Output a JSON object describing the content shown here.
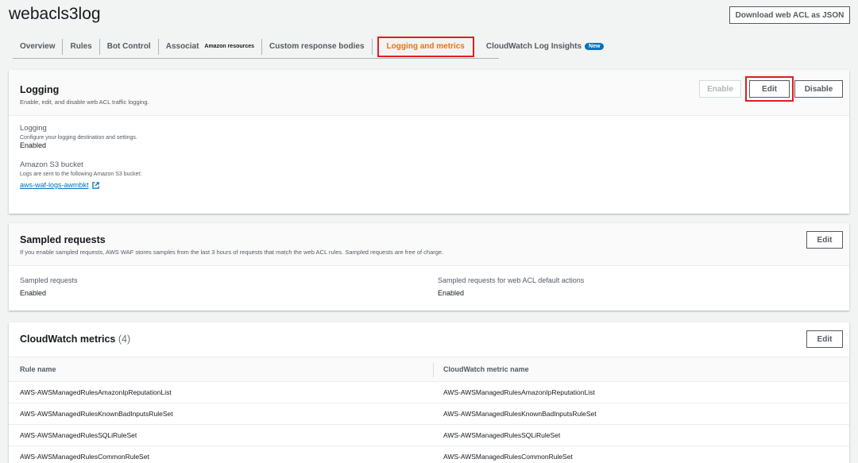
{
  "header": {
    "title": "webacls3log",
    "download_label": "Download web ACL as JSON"
  },
  "tabs": [
    {
      "label": "Overview"
    },
    {
      "label": "Rules"
    },
    {
      "label": "Bot Control"
    },
    {
      "label": "Associat",
      "sub": "Amazon resources"
    },
    {
      "label": "Custom response bodies"
    },
    {
      "label": "Logging and metrics"
    },
    {
      "label": "CloudWatch Log Insights",
      "badge": "New"
    }
  ],
  "logging": {
    "title": "Logging",
    "description": "Enable, edit, and disable web ACL traffic logging.",
    "enable_label": "Enable",
    "edit_label": "Edit",
    "disable_label": "Disable",
    "logging_label": "Logging",
    "logging_sub": "Configure your logging destination and settings.",
    "logging_value": "Enabled",
    "bucket_label": "Amazon S3 bucket",
    "bucket_sub": "Logs are sent to the following Amazon S3 bucket:",
    "bucket_link": "aws-waf-logs-awmbkt"
  },
  "sampled": {
    "title": "Sampled requests",
    "description": "If you enable sampled requests, AWS WAF stores samples from the last 3 hours of requests that match the web ACL rules. Sampled requests are free of charge.",
    "edit_label": "Edit",
    "left_label": "Sampled requests",
    "left_value": "Enabled",
    "right_label": "Sampled requests for web ACL default actions",
    "right_value": "Enabled"
  },
  "metrics": {
    "title": "CloudWatch metrics",
    "count": "(4)",
    "edit_label": "Edit",
    "col_rule": "Rule name",
    "col_metric": "CloudWatch metric name",
    "rows": [
      {
        "rule": "AWS-AWSManagedRulesAmazonIpReputationList",
        "metric": "AWS-AWSManagedRulesAmazonIpReputationList"
      },
      {
        "rule": "AWS-AWSManagedRulesKnownBadInputsRuleSet",
        "metric": "AWS-AWSManagedRulesKnownBadInputsRuleSet"
      },
      {
        "rule": "AWS-AWSManagedRulesSQLiRuleSet",
        "metric": "AWS-AWSManagedRulesSQLiRuleSet"
      },
      {
        "rule": "AWS-AWSManagedRulesCommonRuleSet",
        "metric": "AWS-AWSManagedRulesCommonRuleSet"
      }
    ]
  },
  "colors": {
    "accent_orange": "#ec7211",
    "link_blue": "#0073bb",
    "highlight_red": "#e01e1e"
  }
}
